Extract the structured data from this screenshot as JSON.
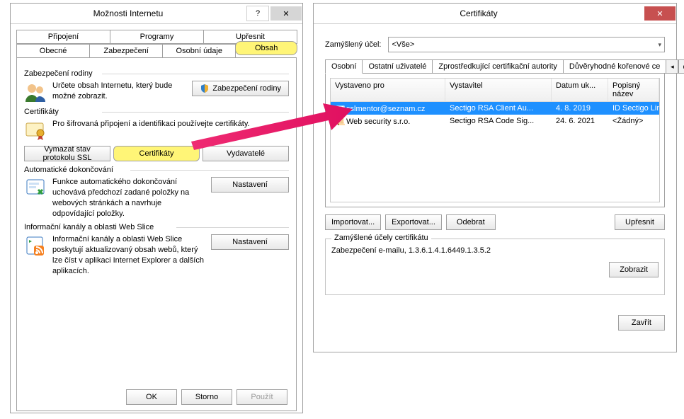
{
  "ioWindow": {
    "title": "Možnosti Internetu",
    "tabs_top": [
      "Připojení",
      "Programy",
      "Upřesnit"
    ],
    "tabs_bottom": [
      "Obecné",
      "Zabezpečení",
      "Osobní údaje",
      "Obsah"
    ],
    "activeTab": "Obsah",
    "sections": {
      "family": {
        "title": "Zabezpečení rodiny",
        "text": "Určete obsah Internetu, který bude možné zobrazit.",
        "button": "Zabezpečení rodiny"
      },
      "certs": {
        "title": "Certifikáty",
        "text": "Pro šifrovaná připojení a identifikaci používejte certifikáty.",
        "btn_clear": "Vymazat stav protokolu SSL",
        "btn_certs": "Certifikáty",
        "btn_pub": "Vydavatelé"
      },
      "auto": {
        "title": "Automatické dokončování",
        "text": "Funkce automatického dokončování uchovává předchozí zadané položky na webových stránkách a navrhuje odpovídající položky.",
        "button": "Nastavení"
      },
      "feeds": {
        "title": "Informační kanály a oblasti Web Slice",
        "text": "Informační kanály a oblasti Web Slice poskytují aktualizovaný obsah webů, který lze číst v aplikaci Internet Explorer a dalších aplikacích.",
        "button": "Nastavení"
      }
    },
    "buttons": {
      "ok": "OK",
      "cancel": "Storno",
      "apply": "Použít"
    }
  },
  "certWindow": {
    "title": "Certifikáty",
    "purposeLabel": "Zamýšlený účel:",
    "purposeValue": "<Vše>",
    "tabs": [
      "Osobní",
      "Ostatní uživatelé",
      "Zprostředkující certifikační autority",
      "Důvěryhodné kořenové ce"
    ],
    "activeTab": "Osobní",
    "columns": [
      "Vystaveno pro",
      "Vystavitel",
      "Datum uk...",
      "Popisný název"
    ],
    "rows": [
      {
        "issued_to": "sslmentor@seznam.cz",
        "issuer": "Sectigo RSA Client Au...",
        "date": "4. 8. 2019",
        "friendly": "ID Sectigo Limite...",
        "selected": true
      },
      {
        "issued_to": "Web security s.r.o.",
        "issuer": "Sectigo RSA Code Sig...",
        "date": "24. 6. 2021",
        "friendly": "<Žádný>",
        "selected": false
      }
    ],
    "btn_import": "Importovat...",
    "btn_export": "Exportovat...",
    "btn_remove": "Odebrat",
    "btn_advanced": "Upřesnit",
    "fieldset_legend": "Zamýšlené účely certifikátu",
    "purposes_text": "Zabezpečení e-mailu, 1.3.6.1.4.1.6449.1.3.5.2",
    "btn_show": "Zobrazit",
    "btn_close": "Zavřít"
  }
}
